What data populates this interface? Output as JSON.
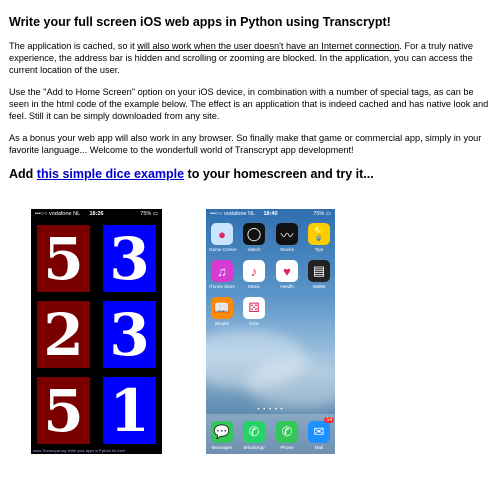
{
  "title": "Write your full screen iOS web apps in Python using Transcrypt!",
  "p1": {
    "a": "The application is cached, so it ",
    "u": "will also work when the user doesn't have an Internet connection",
    "b": ". For a truly native experience, the address bar is hidden and scrolling or zooming are blocked. In the application, you can access the current location of the user."
  },
  "p2": "Use the \"Add to Home Screen\" option on your iOS device, in combination with a number of special tags, as can be seen in the html code of the example below. The effect is an application that is indeed cached and has native look and feel. Still it can be simply downloaded from any site.",
  "p3": "As a bonus your web app will also work in any browser. So finally make that game or commercial app, simply in your favorite language... Welcome to the wonderfull world of Transcrypt app development!",
  "cta": {
    "prefix": "Add ",
    "link": "this simple dice example",
    "suffix": " to your homescreen and try it..."
  },
  "phone1": {
    "status": {
      "carrier": "•••○○ vodafone NL",
      "time": "18:26",
      "battery": "75% ▭"
    },
    "dice": [
      "5",
      "3",
      "2",
      "3",
      "5",
      "1"
    ],
    "footer": "www.Transcrypt.org Write your apps in Python for free!"
  },
  "phone2": {
    "status": {
      "carrier": "•••○○ vodafone NL",
      "time": "18:40",
      "battery": "75% ▭"
    },
    "apps": [
      {
        "label": "Game Center",
        "icon": "game-center-icon",
        "glyph": "●",
        "color": "#c8e4ff"
      },
      {
        "label": "Watch",
        "icon": "watch-icon",
        "glyph": "◯",
        "color": "#111111"
      },
      {
        "label": "Stocks",
        "icon": "stocks-icon",
        "glyph": "〰",
        "color": "#111111"
      },
      {
        "label": "Tips",
        "icon": "tips-icon",
        "glyph": "💡",
        "color": "#ffcc00"
      },
      {
        "label": "iTunes Store",
        "icon": "itunes-store-icon",
        "glyph": "♫",
        "color": "#d63ad0"
      },
      {
        "label": "Music",
        "icon": "music-icon",
        "glyph": "♪",
        "color": "#ffffff"
      },
      {
        "label": "Health",
        "icon": "health-icon",
        "glyph": "♥",
        "color": "#ffffff"
      },
      {
        "label": "Wallet",
        "icon": "wallet-icon",
        "glyph": "▤",
        "color": "#222222"
      },
      {
        "label": "iBooks",
        "icon": "ibooks-icon",
        "glyph": "📖",
        "color": "#ff8a00"
      },
      {
        "label": "Dice",
        "icon": "dice-icon",
        "glyph": "⚄",
        "color": "#ffffff"
      }
    ],
    "dots": "• • • • •",
    "dock": [
      {
        "label": "Messages",
        "icon": "messages-icon",
        "glyph": "💬",
        "color": "#35c659"
      },
      {
        "label": "WhatsApp",
        "icon": "whatsapp-icon",
        "glyph": "✆",
        "color": "#25d366"
      },
      {
        "label": "Phone",
        "icon": "phone-icon",
        "glyph": "✆",
        "color": "#35c659"
      },
      {
        "label": "Mail",
        "icon": "mail-icon",
        "glyph": "✉",
        "color": "#1e90ff",
        "badge": "14"
      }
    ]
  }
}
